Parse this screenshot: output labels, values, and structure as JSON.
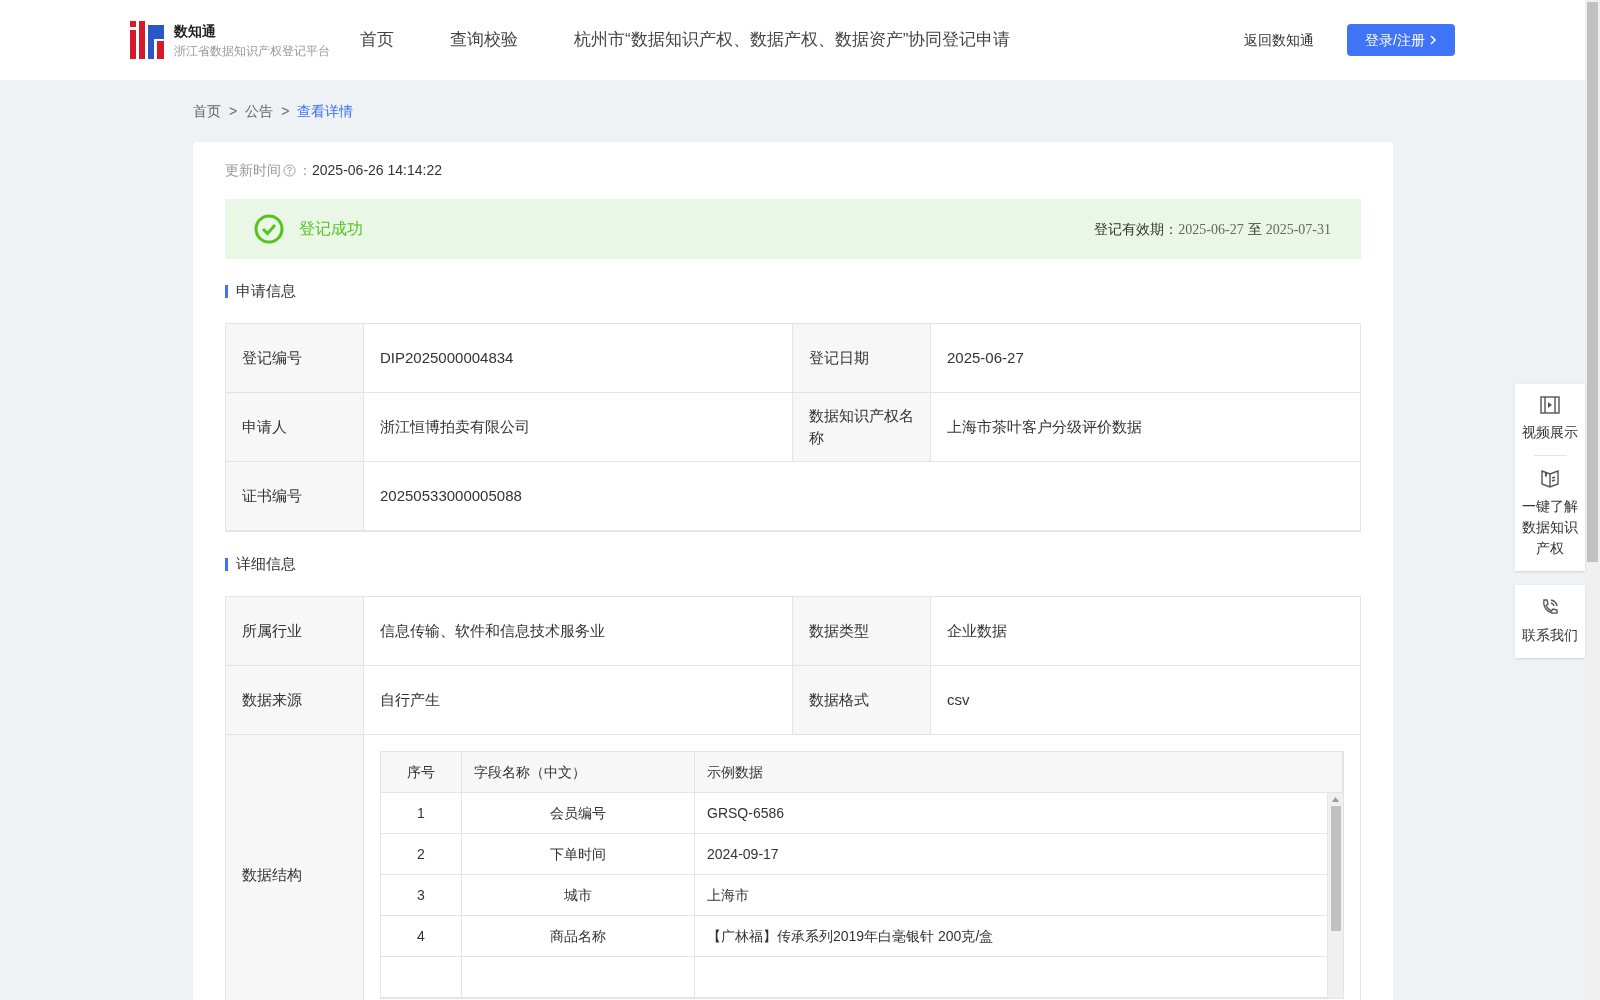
{
  "header": {
    "logo_title": "数知通",
    "logo_subtitle": "浙江省数据知识产权登记平台",
    "nav": [
      {
        "label": "首页",
        "selected": false
      },
      {
        "label": "查询校验",
        "selected": false
      },
      {
        "label": "杭州市“数据知识产权、数据产权、数据资产”协同登记申请",
        "selected": false
      }
    ],
    "back_link": "返回数知通",
    "login_button": "登录/注册"
  },
  "breadcrumb": [
    {
      "label": "首页",
      "current": false
    },
    {
      "label": "公告",
      "current": false
    },
    {
      "label": "查看详情",
      "current": true
    }
  ],
  "breadcrumb_separator": ">",
  "updated": {
    "label": "更新时间",
    "colon": "：",
    "value": "2025-06-26 14:14:22"
  },
  "status": {
    "text": "登记成功",
    "validity_label": "登记有效期：",
    "validity_from": "2025-06-27",
    "validity_to_word": "至",
    "validity_to": "2025-07-31"
  },
  "application_info": {
    "title": "申请信息",
    "rows": [
      {
        "cells": [
          {
            "label": "登记编号",
            "value": "DIP2025000004834"
          },
          {
            "label": "登记日期",
            "value": "2025-06-27"
          }
        ]
      },
      {
        "cells": [
          {
            "label": "申请人",
            "value": "浙江恒博拍卖有限公司"
          },
          {
            "label": "数据知识产权名称",
            "value": "上海市茶叶客户分级评价数据"
          }
        ]
      },
      {
        "cells": [
          {
            "label": "证书编号",
            "value": "20250533000005088"
          }
        ]
      }
    ]
  },
  "detail_info": {
    "title": "详细信息",
    "rows": [
      {
        "cells": [
          {
            "label": "所属行业",
            "value": "信息传输、软件和信息技术服务业"
          },
          {
            "label": "数据类型",
            "value": "企业数据"
          }
        ]
      },
      {
        "cells": [
          {
            "label": "数据来源",
            "value": "自行产生"
          },
          {
            "label": "数据格式",
            "value": "csv"
          }
        ]
      }
    ],
    "structure": {
      "label": "数据结构",
      "columns": [
        "序号",
        "字段名称（中文）",
        "示例数据"
      ],
      "rows": [
        [
          "1",
          "会员编号",
          "GRSQ-6586"
        ],
        [
          "2",
          "下单时间",
          "2024-09-17"
        ],
        [
          "3",
          "城市",
          "上海市"
        ],
        [
          "4",
          "商品名称",
          "【广林福】传承系列2019年白毫银针 200克/盒"
        ]
      ]
    }
  },
  "side_panel": [
    {
      "kind": "video",
      "label": "视频展示"
    },
    {
      "kind": "book",
      "label": "一键了解数据知识产权"
    },
    {
      "kind": "phone",
      "label": "联系我们"
    }
  ]
}
